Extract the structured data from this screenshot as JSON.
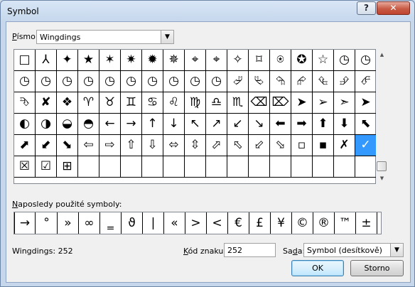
{
  "window": {
    "title": "Symbol",
    "help_label": "?",
    "close_label": "✕"
  },
  "font": {
    "label_prefix": "P",
    "label_rest": "ísmo:",
    "value": "Wingdings"
  },
  "grid": {
    "rows": [
      [
        "□",
        "⅄",
        "✦",
        "★",
        "✶",
        "✷",
        "✹",
        "✵",
        "⌖",
        "⌖",
        "✧",
        "⌑",
        "⍟",
        "✪",
        "☆",
        "◷",
        "◷"
      ],
      [
        "◷",
        "◷",
        "◷",
        "◷",
        "◷",
        "◷",
        "◷",
        "◷",
        "◷",
        "◷",
        "⮰",
        "⮱",
        "⮲",
        "⮳",
        "⮴",
        "⮵",
        "⮶"
      ],
      [
        "⮷",
        "✘",
        "❖",
        "♈",
        "♉",
        "♊",
        "♋",
        "♌",
        "♍",
        "♎",
        "♏",
        "⌫",
        "⌦",
        "➤",
        "➢",
        "➣",
        "➤"
      ],
      [
        "◐",
        "◑",
        "◒",
        "◓",
        "←",
        "→",
        "↑",
        "↓",
        "↖",
        "↗",
        "↙",
        "↘",
        "⬅",
        "➡",
        "⬆",
        "⬇",
        "⬉"
      ],
      [
        "⬈",
        "⬋",
        "⬊",
        "⇦",
        "⇨",
        "⇧",
        "⇩",
        "⬄",
        "⇳",
        "⬀",
        "⬁",
        "⬃",
        "⬂",
        "▫",
        "▪",
        "✗",
        "✓"
      ],
      [
        "☒",
        "☑",
        "⊞",
        "",
        "",
        "",
        "",
        "",
        "",
        "",
        "",
        "",
        "",
        "",
        "",
        "",
        ""
      ]
    ],
    "selected_row": 4,
    "selected_col": 16
  },
  "recent": {
    "label_prefix": "N",
    "label_rest": "aposledy použité symboly:",
    "symbols": [
      "→",
      "°",
      "»",
      "∞",
      "‗",
      "ϑ",
      "|",
      "«",
      ">",
      "<",
      "€",
      "£",
      "¥",
      "©",
      "®",
      "™",
      "±"
    ]
  },
  "status": {
    "text": "Wingdings: 252"
  },
  "code": {
    "label_prefix": "K",
    "label_rest": "ód znaku:",
    "value": "252"
  },
  "charset": {
    "label_prefix": "Sa",
    "label_u": "d",
    "label_rest": "a:",
    "value": "Symbol (desítkově)"
  },
  "buttons": {
    "ok": "OK",
    "cancel": "Storno"
  }
}
